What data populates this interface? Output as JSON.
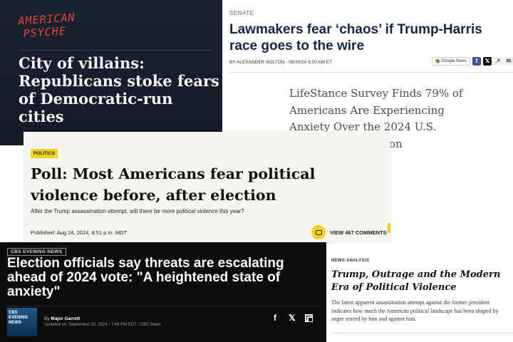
{
  "psyche": {
    "logo_line1": "AMERICAN",
    "logo_line2": "PSYCHE",
    "headline": "City of villains: Republicans stoke fears of Democratic-run cities"
  },
  "hill": {
    "section": "SENATE",
    "headline": "Lawmakers fear ‘chaos’ if Trump-Harris race goes to the wire",
    "byline": "BY ALEXANDER BOLTON - 08/30/24 6:00 AM ET",
    "share": {
      "gnews_label": "Google News",
      "fb": "f",
      "x": "𝕏",
      "share": "↗",
      "mail": "✉"
    }
  },
  "lifestance": {
    "headline": "LifeStance Survey Finds 79% of Americans Are Experiencing Anxiety Over the 2024 U.S. Presidential Election"
  },
  "poll": {
    "tag": "POLITICS",
    "headline": "Poll: Most Americans fear political violence before, after election",
    "dek": "After the Trump assassination attempt, will there be more political violence this year?",
    "published": "Published: Aug 24, 2024, 8:51 p.m. MDT",
    "comments_label": "VIEW 467 COMMENTS"
  },
  "cbs": {
    "program_label": "CBS EVENING NEWS",
    "headline": "Election officials say threats are escalating ahead of 2024 vote: \"A heightened state of anxiety\"",
    "logo_text": "CBS EVENING NEWS",
    "author_prefix": "By",
    "author_name": "Major Garrett",
    "updated": "Updated on: September 10, 2024 / 7:49 PM EDT / CBS News",
    "social": {
      "facebook": "f",
      "x": "𝕏"
    }
  },
  "nyt": {
    "kicker": "NEWS ANALYSIS",
    "headline": "Trump, Outrage and the Modern Era of Political Violence",
    "dek": "The latest apparent assassination attempt against the former president indicates how much the American political landscape has been shaped by anger stirred by him and against him."
  }
}
